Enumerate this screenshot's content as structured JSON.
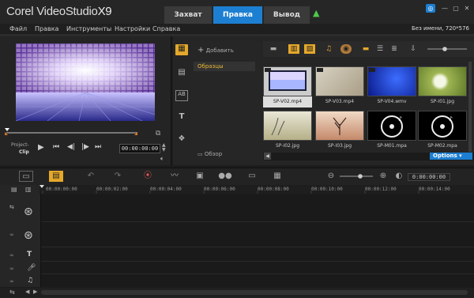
{
  "app": {
    "brand": "Corel",
    "product": "VideoStudio",
    "version": "X9"
  },
  "tabs": [
    {
      "label": "Захват",
      "active": false
    },
    {
      "label": "Правка",
      "active": true
    },
    {
      "label": "Вывод",
      "active": false
    }
  ],
  "menu": [
    "Файл",
    "Правка",
    "Инструменты",
    "Настройки",
    "Справка"
  ],
  "project_info": "Без имени, 720*576",
  "player": {
    "project_label": "Project-",
    "clip_label": "Clip",
    "timecode": "00:00:00:00"
  },
  "library": {
    "add_label": "Добавить",
    "folder": "Образцы",
    "browse_label": "Обзор",
    "options_label": "Options",
    "thumbnails": [
      {
        "name": "SP-V02.mp4",
        "selected": true
      },
      {
        "name": "SP-V03.mp4",
        "selected": false
      },
      {
        "name": "SP-V04.wmv",
        "selected": false
      },
      {
        "name": "SP-I01.jpg",
        "selected": false
      },
      {
        "name": "SP-I02.jpg",
        "selected": false
      },
      {
        "name": "SP-I03.jpg",
        "selected": false
      },
      {
        "name": "SP-M01.mpa",
        "selected": false
      },
      {
        "name": "SP-M02.mpa",
        "selected": false
      }
    ]
  },
  "timeline": {
    "ruler": [
      "00:00:00:00",
      "00:00:02:00",
      "00:00:04:00",
      "00:00:06:00",
      "00:00:08:00",
      "00:00:10:00",
      "00:00:12:00",
      "00:00:14:00"
    ],
    "zoom_timecode": "0:00:00:00"
  },
  "colors": {
    "accent": "#1d7fd1",
    "folder_text": "#ecb935",
    "upload_arrow": "#4fc94a"
  }
}
